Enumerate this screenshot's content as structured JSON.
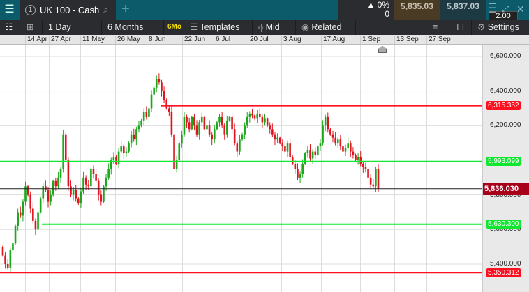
{
  "header": {
    "menu_icon": "hamburger-icon",
    "tab_number": "1",
    "instrument": "UK 100 - Cash",
    "change_pct": "0%",
    "change_abs": "0",
    "sell_price": "5,835.03",
    "buy_price": "5,837.03",
    "spread": "2.00"
  },
  "toolbar": {
    "interval": "1 Day",
    "range": "6 Months",
    "range_badge": "6Mo",
    "templates": "Templates",
    "price_type": "Mid",
    "related": "Related",
    "settings": "Settings",
    "tt": "TT"
  },
  "colors": {
    "up": "#1aa81a",
    "down": "#e0141e",
    "support": "#10e830",
    "resistance": "#ff1020",
    "current": "#a8001a"
  },
  "chart_data": {
    "type": "candlestick",
    "x_ticks": [
      "14 Apr",
      "27 Apr",
      "11 May",
      "26 May",
      "8 Jun",
      "22 Jun",
      "6 Jul",
      "20 Jul",
      "3 Aug",
      "17 Aug",
      "1 Sep",
      "13 Sep",
      "27 Sep"
    ],
    "y_ticks": [
      "6,600.000",
      "6,400.000",
      "6,200.000",
      "5,800.000",
      "5,600.000",
      "5,400.000"
    ],
    "ylim": [
      5300,
      6650
    ],
    "closes": [
      5450,
      5400,
      5380,
      5480,
      5520,
      5620,
      5700,
      5680,
      5760,
      5850,
      5800,
      5720,
      5650,
      5600,
      5700,
      5780,
      5850,
      5830,
      5760,
      5800,
      5880,
      5850,
      5900,
      5950,
      6150,
      6000,
      5850,
      5800,
      5830,
      5780,
      5750,
      5820,
      5900,
      5860,
      5850,
      5950,
      5920,
      5880,
      5800,
      5760,
      5850,
      5900,
      5950,
      6000,
      6020,
      5980,
      6050,
      6080,
      6040,
      6050,
      6100,
      6150,
      6120,
      6180,
      6200,
      6230,
      6280,
      6250,
      6300,
      6380,
      6420,
      6470,
      6450,
      6400,
      6350,
      6300,
      6280,
      6150,
      5950,
      6000,
      6100,
      6150,
      6250,
      6220,
      6180,
      6250,
      6200,
      6150,
      6220,
      6250,
      6180,
      6200,
      6150,
      6120,
      6180,
      6220,
      6250,
      6200,
      6150,
      6230,
      6250,
      6180,
      6100,
      6050,
      6120,
      6150,
      6200,
      6250,
      6270,
      6260,
      6240,
      6270,
      6250,
      6220,
      6240,
      6200,
      6180,
      6150,
      6120,
      6130,
      6100,
      6080,
      6050,
      6100,
      6020,
      5980,
      5950,
      5900,
      5920,
      5980,
      6040,
      6060,
      6010,
      6050,
      6030,
      6080,
      6100,
      6200,
      6250,
      6180,
      6150,
      6130,
      6100,
      6120,
      6080,
      6050,
      6070,
      6100,
      6050,
      6030,
      6000,
      6020,
      5980,
      5960,
      5950,
      5900,
      5860,
      5850,
      5950,
      5836
    ],
    "levels": [
      {
        "value": 5350.312,
        "label": "5,350.312",
        "kind": "resistance"
      },
      {
        "value": 5630.3,
        "label": "5,630.300",
        "kind": "support"
      },
      {
        "value": 5836.03,
        "label": "5,836.030",
        "kind": "current"
      },
      {
        "value": 5993.099,
        "label": "5,993.099",
        "kind": "support"
      },
      {
        "value": 6315.352,
        "label": "6,315.352",
        "kind": "resistance"
      }
    ]
  }
}
